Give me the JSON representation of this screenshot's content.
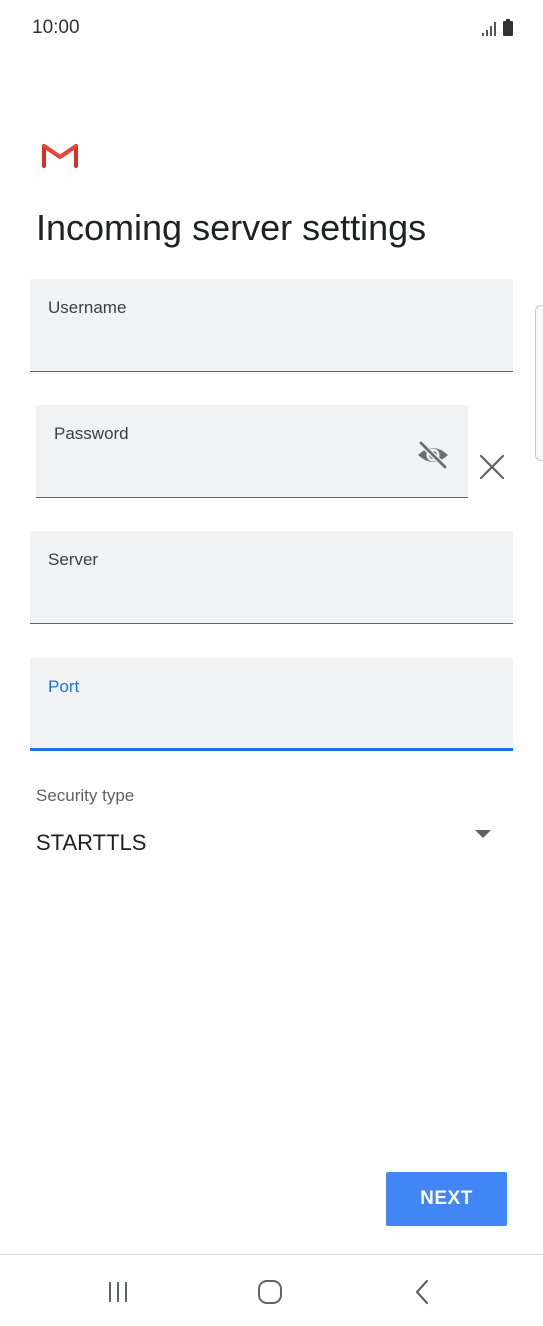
{
  "status_bar": {
    "time": "10:00",
    "icons": [
      "signal-icon",
      "battery-icon"
    ]
  },
  "app": {
    "logo": "gmail-logo"
  },
  "page": {
    "title": "Incoming server settings"
  },
  "form": {
    "username": {
      "label": "Username",
      "value": ""
    },
    "password": {
      "label": "Password",
      "value": "",
      "toggle_icon": "visibility-off-icon"
    },
    "server": {
      "label": "Server",
      "value": ""
    },
    "port": {
      "label": "Port",
      "value": "",
      "focused": true
    },
    "security": {
      "label": "Security type",
      "value": "STARTTLS"
    }
  },
  "actions": {
    "next_label": "NEXT"
  },
  "navigation": {
    "icons": [
      "recents-icon",
      "home-icon",
      "back-icon"
    ]
  },
  "colors": {
    "accent": "#1a73e8",
    "button": "#4285f4",
    "field_background": "#f1f2f4",
    "gmail_red": "#d93025"
  }
}
